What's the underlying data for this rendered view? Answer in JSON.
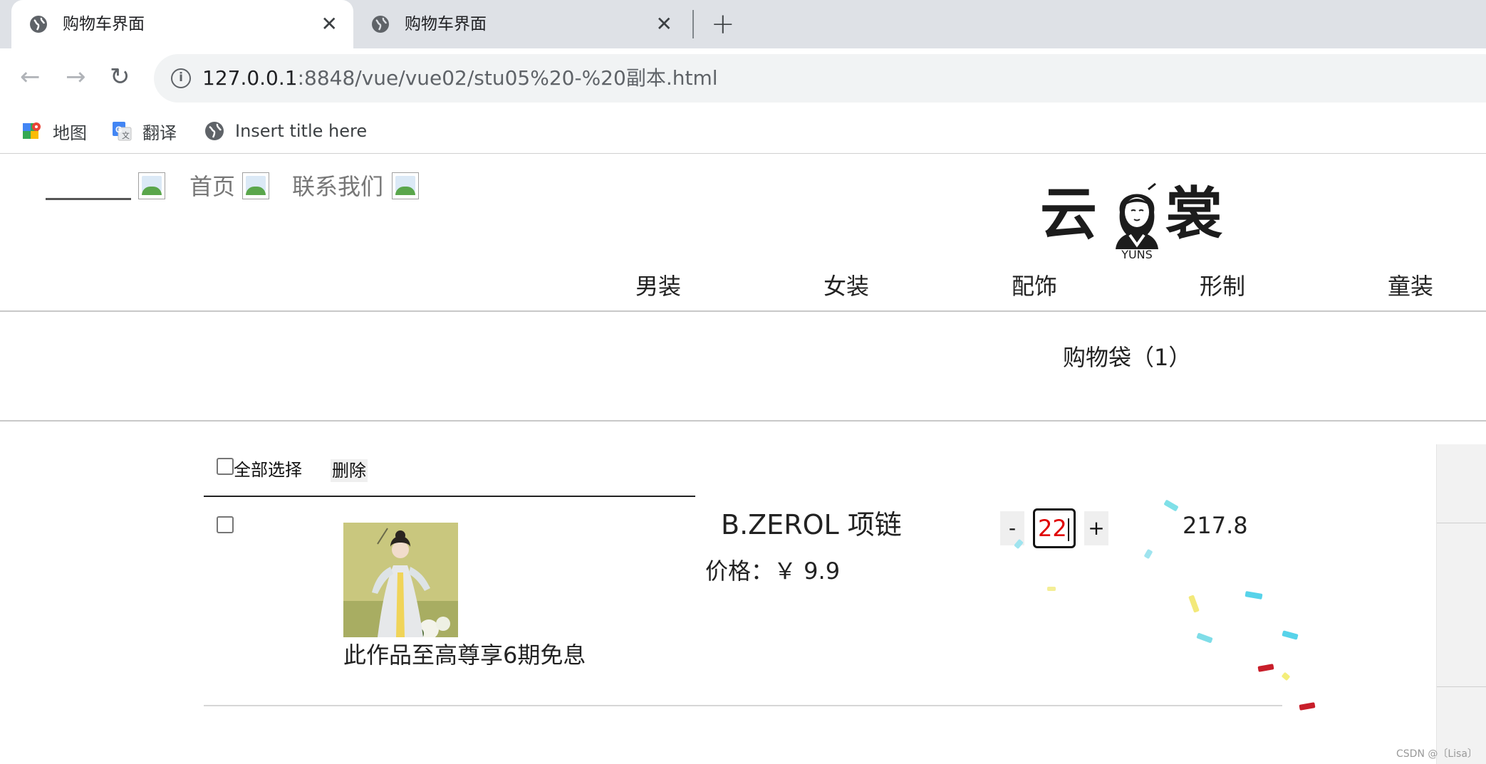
{
  "browser": {
    "tabs": [
      {
        "title": "购物车界面",
        "active": true
      },
      {
        "title": "购物车界面",
        "active": false
      }
    ],
    "url_host": "127.0.0.1",
    "url_rest": ":8848/vue/vue02/stu05%20-%20副本.html",
    "bookmarks": [
      {
        "label": "地图",
        "icon": "maps-icon"
      },
      {
        "label": "翻译",
        "icon": "translate-icon"
      },
      {
        "label": "Insert title here",
        "icon": "globe-icon"
      }
    ]
  },
  "header": {
    "links": [
      "首页",
      "联系我们"
    ],
    "logo": {
      "left": "云",
      "right": "裳",
      "sub": "YUNS"
    },
    "categories": [
      "男装",
      "女装",
      "配饰",
      "形制",
      "童装"
    ]
  },
  "cart": {
    "title": "购物袋（1）",
    "select_all_label": "全部选择",
    "delete_label": "删除",
    "item": {
      "name": "B.ZEROL 项链",
      "price": "价格：￥ 9.9",
      "promo": "此作品至高尊享6期免息",
      "quantity": "22",
      "decrement": "-",
      "increment": "+",
      "subtotal": "217.8"
    }
  },
  "watermark": "CSDN @〔Lisa〕"
}
